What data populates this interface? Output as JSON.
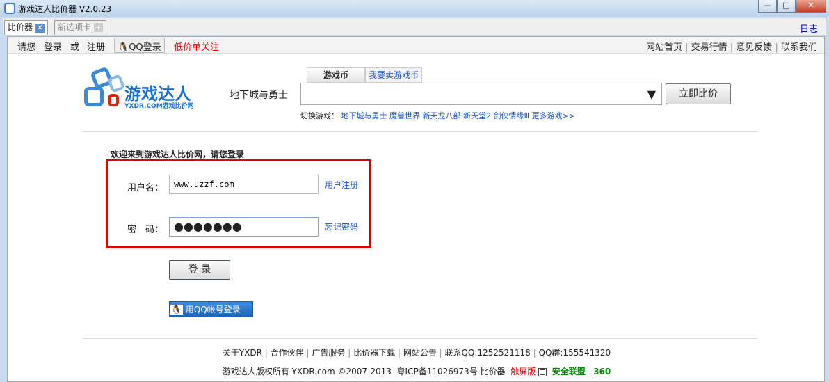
{
  "window": {
    "title": "游戏达人比价器 V2.0.23",
    "minimize": "—",
    "maximize": "□",
    "close": "✕"
  },
  "tabs": [
    {
      "label": "比价器",
      "icon": "close-icon"
    },
    {
      "label": "新选项卡",
      "icon": "plus-icon"
    }
  ],
  "log_link": "日志",
  "topnav": {
    "left": [
      "请您",
      "登录",
      "或",
      "注册"
    ],
    "qq_login": "QQ登录",
    "low_price": "低价单关注",
    "right": [
      "网站首页",
      "交易行情",
      "意见反馈",
      "联系我们"
    ]
  },
  "logo": {
    "text": "游戏达人",
    "sub": "YXDR.COM游戏比价网"
  },
  "search": {
    "tabs": [
      "游戏币",
      "我要卖游戏币"
    ],
    "game_label": "地下城与勇士",
    "value": "",
    "button": "立即比价",
    "switch_label": "切换游戏：",
    "games": [
      "地下城与勇士",
      "魔兽世界",
      "新天龙八部",
      "新天堂2",
      "剑侠情缘Ⅲ",
      "更多游戏>>"
    ]
  },
  "login": {
    "heading": "欢迎来到游戏达人比价网，请您登录",
    "username_label": "用户名：",
    "username_value": "www.uzzf.com",
    "register": "用户注册",
    "password_label": "密　码：",
    "password_value": "●●●●●●●",
    "forgot": "忘记密码",
    "submit": "登 录",
    "qq_button": "用QQ帐号登录",
    "highlight_color": "#e00000"
  },
  "footer": {
    "links": [
      "关于YXDR",
      "合作伙伴",
      "广告服务",
      "比价器下载",
      "网站公告",
      "联系QQ:1252521118",
      "QQ群:155541320"
    ],
    "copyright": "游戏达人版权所有 YXDR.com ©2007-2013",
    "icp": "粤ICP备11026973号",
    "app": "比价器",
    "touch": "触屏版",
    "safe": "安全联盟",
    "n360": "360"
  }
}
